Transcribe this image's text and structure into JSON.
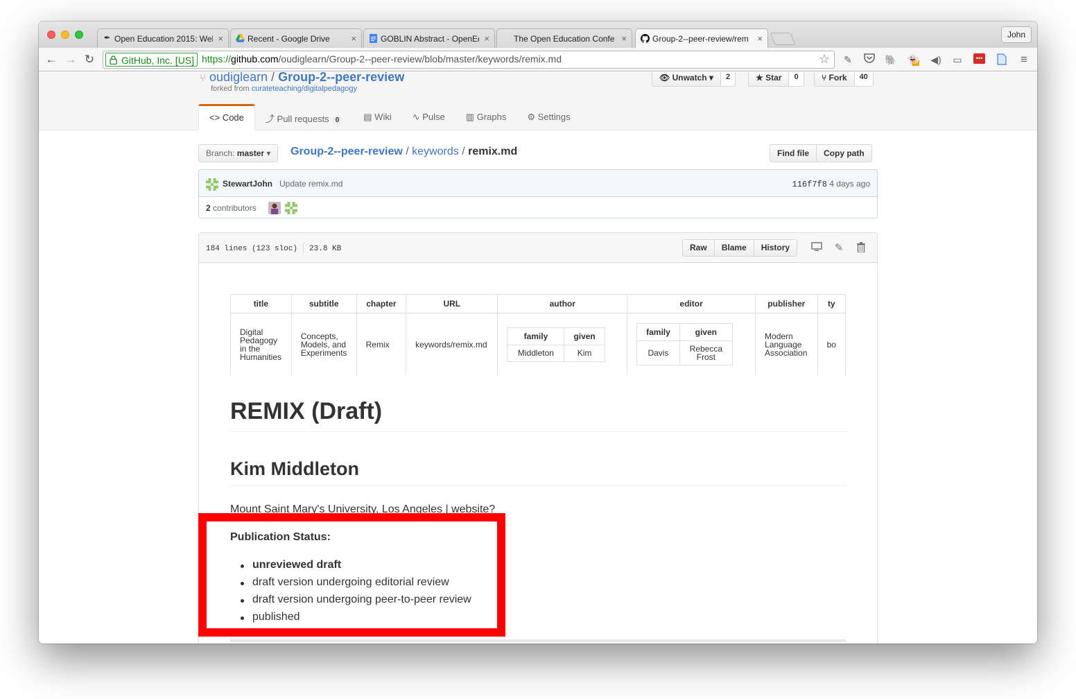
{
  "browser": {
    "tabs": [
      {
        "icon": "quill-icon",
        "title": "Open Education 2015: Wel"
      },
      {
        "icon": "google-drive-icon",
        "title": "Recent - Google Drive"
      },
      {
        "icon": "google-docs-icon",
        "title": "GOBLIN Abstract - OpenEd"
      },
      {
        "icon": "blank-icon",
        "title": "The Open Education Confe"
      },
      {
        "icon": "github-icon",
        "title": "Group-2--peer-review/rem"
      }
    ],
    "profile_name": "John",
    "ev_label": "GitHub, Inc. [US]",
    "url_scheme": "https://",
    "url_host": "github.com",
    "url_path": "/oudiglearn/Group-2--peer-review/blob/master/keywords/remix.md",
    "extension_badge": "off"
  },
  "repo": {
    "owner": "oudiglearn",
    "separator": "/",
    "name": "Group-2--peer-review",
    "forked_from_label": "forked from",
    "forked_from": "curateteaching/digitalpedagogy",
    "unwatch_label": "Unwatch",
    "unwatch_count": "2",
    "star_label": "Star",
    "star_count": "0",
    "fork_label": "Fork",
    "fork_count": "40"
  },
  "nav": {
    "code": "Code",
    "pull_requests": "Pull requests",
    "pull_requests_count": "0",
    "wiki": "Wiki",
    "pulse": "Pulse",
    "graphs": "Graphs",
    "settings": "Settings"
  },
  "file_nav": {
    "branch_label": "Branch:",
    "branch_name": "master",
    "crumb_repo": "Group-2--peer-review",
    "crumb_dir": "keywords",
    "crumb_file": "remix.md",
    "find_file": "Find file",
    "copy_path": "Copy path"
  },
  "commit": {
    "author": "StewartJohn",
    "message": "Update remix.md",
    "sha": "116f7f8",
    "time": "4 days ago",
    "contributors_count": "2",
    "contributors_label": "contributors"
  },
  "file": {
    "lines": "184 lines (123 sloc)",
    "size": "23.8 KB",
    "raw": "Raw",
    "blame": "Blame",
    "history": "History"
  },
  "meta_table": {
    "headers": [
      "title",
      "subtitle",
      "chapter",
      "URL",
      "author",
      "editor",
      "publisher",
      "ty"
    ],
    "title": "Digital Pedagogy in the Humanities",
    "subtitle": "Concepts, Models, and Experiments",
    "chapter": "Remix",
    "url": "keywords/remix.md",
    "author": {
      "headers": [
        "family",
        "given"
      ],
      "family": "Middleton",
      "given": "Kim"
    },
    "editor": {
      "headers": [
        "family",
        "given"
      ],
      "family": "Davis",
      "given": "Rebecca Frost"
    },
    "publisher": "Modern Language Association",
    "type_partial": "bo"
  },
  "content": {
    "heading": "REMIX (Draft)",
    "author_name": "Kim Middleton",
    "affiliation": "Mount Saint Mary's University, Los Angeles | website?",
    "status_label": "Publication Status:",
    "status_items": [
      "unreviewed draft",
      "draft version undergoing editorial review",
      "draft version undergoing peer-to-peer review",
      "published"
    ]
  },
  "annotation": {
    "color": "#ff0000"
  }
}
